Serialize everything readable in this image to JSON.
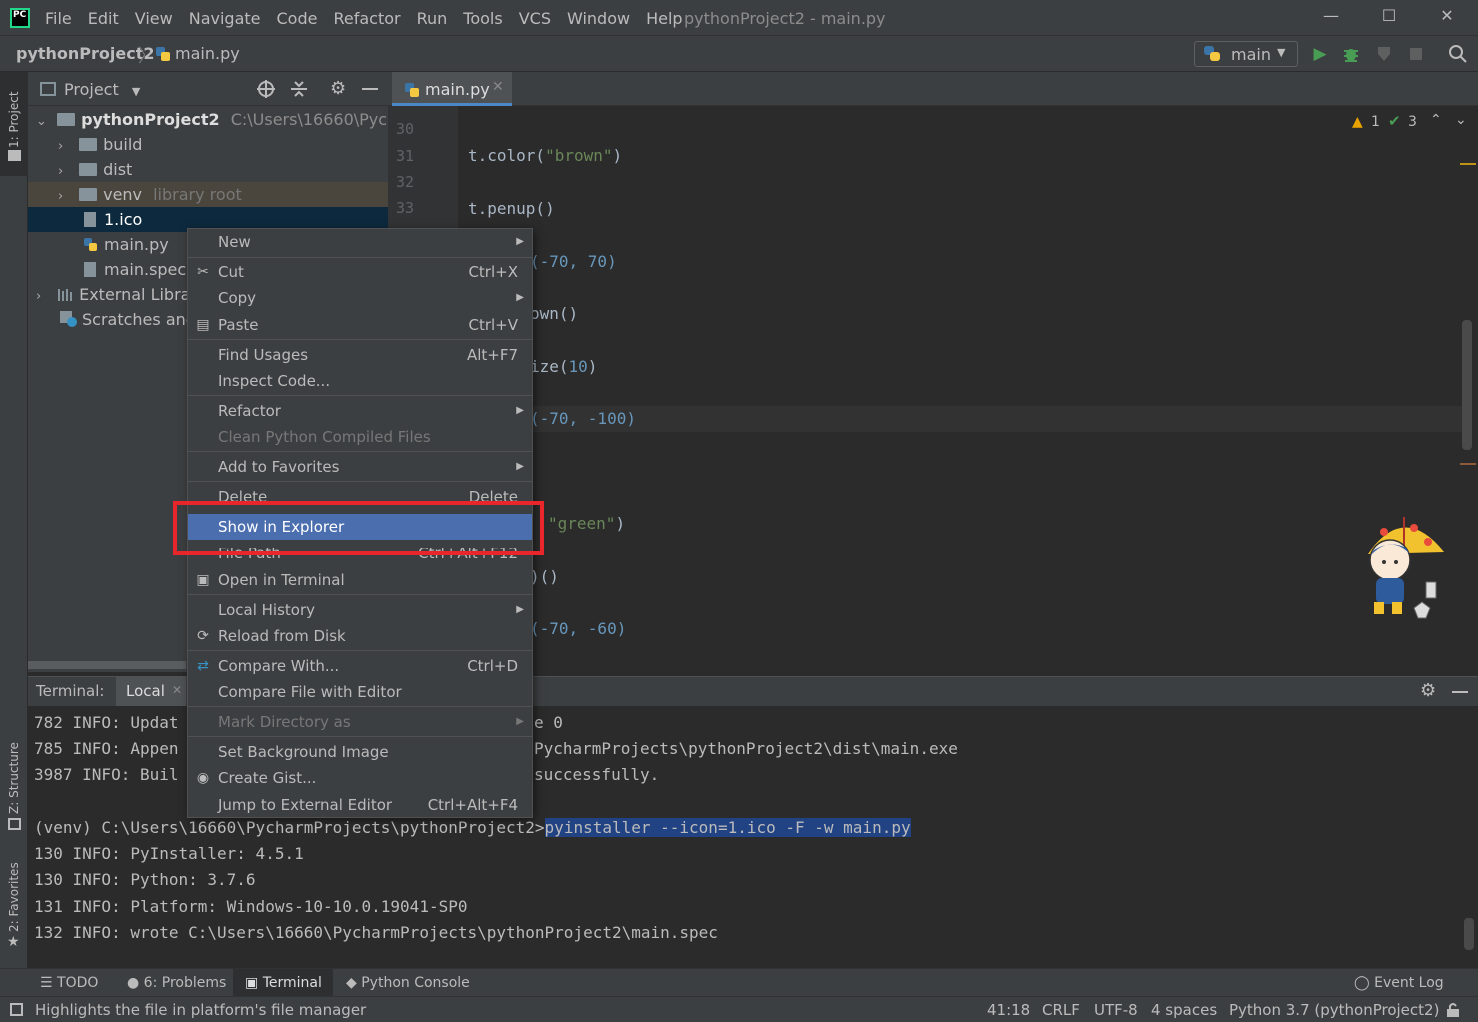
{
  "menubar": {
    "logo": "PC",
    "items": [
      "File",
      "Edit",
      "View",
      "Navigate",
      "Code",
      "Refactor",
      "Run",
      "Tools",
      "VCS",
      "Window",
      "Help"
    ],
    "window_title": "pythonProject2 - main.py",
    "minimize": "—",
    "maximize": "☐",
    "close": "✕"
  },
  "navbar": {
    "project": "pythonProject2",
    "separator": "〉",
    "file": "main.py",
    "run_config": "main"
  },
  "left_stripe": {
    "project_tab": "1: Project",
    "structure_tab": "Z: Structure",
    "favorites_tab": "2: Favorites"
  },
  "project_panel": {
    "title": "Project",
    "tree": {
      "root_name": "pythonProject2",
      "root_path": "C:\\Users\\16660\\Pycharm",
      "build": "build",
      "dist": "dist",
      "venv": "venv",
      "venv_hint": "library root",
      "ico": "1.ico",
      "main_py": "main.py",
      "main_spec": "main.spec",
      "external": "External Librar",
      "scratches": "Scratches and"
    }
  },
  "editor": {
    "tab_label": "main.py",
    "inspections": {
      "warnings": "1",
      "ok": "3"
    },
    "lines": {
      "n30": "30",
      "n31": "31",
      "n32": "32",
      "n33": "33",
      "l31_a": "t.color(",
      "l31_s": "\"brown\"",
      "l31_b": ")",
      "l33": "t.penup()",
      "p1": "(-70, 70)",
      "p2": "own()",
      "p3_a": "ize(",
      "p3_n": "10",
      "p3_b": ")",
      "p4": "(-70, -100)",
      "p5_s": "\"green\"",
      "p5_b": ")",
      "p6": ")()",
      "p7": "(-70, -60)"
    }
  },
  "terminal": {
    "label": "Terminal:",
    "tab": "Local",
    "lines": {
      "t1a": "782 INFO: Updat",
      "t1b": "e 0",
      "t2a": "785 INFO: Appen",
      "t2b": "PycharmProjects\\pythonProject2\\dist\\main.exe",
      "t3a": "3987 INFO: Buil",
      "t3b": "successfully.",
      "prompt": "(venv) C:\\Users\\16660\\PycharmProjects\\pythonProject2>",
      "command": "pyinstaller --icon=1.ico -F -w main.py",
      "t5": "130 INFO: PyInstaller: 4.5.1",
      "t6": "130 INFO: Python: 3.7.6",
      "t7": "131 INFO: Platform: Windows-10-10.0.19041-SP0",
      "t8": "132 INFO: wrote C:\\Users\\16660\\PycharmProjects\\pythonProject2\\main.spec"
    }
  },
  "context_menu": {
    "new": "New",
    "cut": "Cut",
    "cut_sc": "Ctrl+X",
    "copy": "Copy",
    "paste": "Paste",
    "paste_sc": "Ctrl+V",
    "find_usages": "Find Usages",
    "find_usages_sc": "Alt+F7",
    "inspect": "Inspect Code...",
    "refactor": "Refactor",
    "clean": "Clean Python Compiled Files",
    "add_fav": "Add to Favorites",
    "delete": "Delete",
    "delete_sc": "Delete",
    "show_explorer": "Show in Explorer",
    "file_path": "File Path",
    "file_path_sc": "Ctrl+Alt+F12",
    "open_terminal": "Open in Terminal",
    "local_history": "Local History",
    "reload": "Reload from Disk",
    "compare_with": "Compare With...",
    "compare_with_sc": "Ctrl+D",
    "compare_editor": "Compare File with Editor",
    "mark_dir": "Mark Directory as",
    "set_bg": "Set Background Image",
    "gist": "Create Gist...",
    "ext_editor": "Jump to External Editor",
    "ext_editor_sc": "Ctrl+Alt+F4"
  },
  "toolwindows": {
    "todo": "TODO",
    "problems": "6: Problems",
    "terminal": "Terminal",
    "console": "Python Console",
    "event_log": "Event Log"
  },
  "statusbar": {
    "message": "Highlights the file in platform's file manager",
    "position": "41:18",
    "line_sep": "CRLF",
    "encoding": "UTF-8",
    "indent": "4 spaces",
    "interpreter": "Python 3.7 (pythonProject2)"
  },
  "colors": {
    "selection": "#4b6eaf",
    "highlight_box": "#e8262b",
    "run_green": "#499c54"
  }
}
